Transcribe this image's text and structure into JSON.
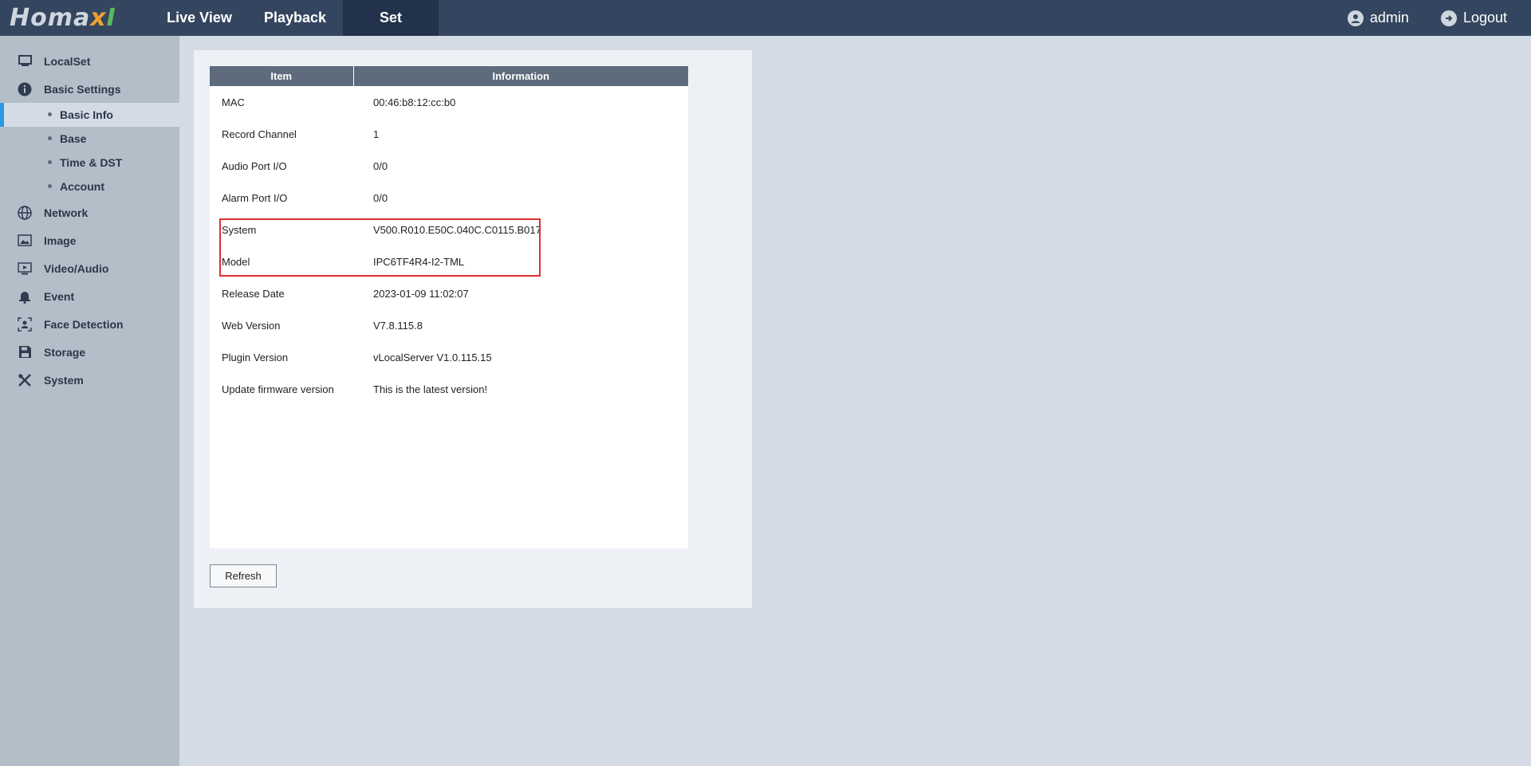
{
  "header": {
    "logo": {
      "part1": "Homa",
      "part2": "x",
      "part3": "I"
    },
    "tabs": [
      {
        "label": "Live View"
      },
      {
        "label": "Playback"
      },
      {
        "label": "Set",
        "active": true
      }
    ],
    "user": {
      "label": "admin",
      "icon": "user-icon"
    },
    "logout": {
      "label": "Logout",
      "icon": "logout-icon"
    },
    "bg_color": "#34465f",
    "active_tab_color": "#22324a"
  },
  "sidebar": {
    "items": [
      {
        "label": "LocalSet",
        "icon": "monitor-icon"
      },
      {
        "label": "Basic Settings",
        "icon": "info-icon"
      },
      {
        "label": "Network",
        "icon": "globe-icon"
      },
      {
        "label": "Image",
        "icon": "image-icon"
      },
      {
        "label": "Video/Audio",
        "icon": "video-icon"
      },
      {
        "label": "Event",
        "icon": "bell-icon"
      },
      {
        "label": "Face Detection",
        "icon": "face-scan-icon"
      },
      {
        "label": "Storage",
        "icon": "save-icon"
      },
      {
        "label": "System",
        "icon": "tools-icon"
      }
    ],
    "sub_items": [
      {
        "label": "Basic Info",
        "active": true
      },
      {
        "label": "Base"
      },
      {
        "label": "Time & DST"
      },
      {
        "label": "Account"
      }
    ],
    "accent_color": "#2a9ae0"
  },
  "table": {
    "headers": [
      "Item",
      "Information"
    ],
    "rows": [
      {
        "item": "MAC",
        "info": "00:46:b8:12:cc:b0"
      },
      {
        "item": "Record Channel",
        "info": "1"
      },
      {
        "item": "Audio Port I/O",
        "info": "0/0"
      },
      {
        "item": "Alarm Port I/O",
        "info": "0/0"
      },
      {
        "item": "System",
        "info": "V500.R010.E50C.040C.C0115.B017"
      },
      {
        "item": "Model",
        "info": "IPC6TF4R4-I2-TML"
      },
      {
        "item": "Release Date",
        "info": "2023-01-09 11:02:07"
      },
      {
        "item": "Web Version",
        "info": "V7.8.115.8"
      },
      {
        "item": "Plugin Version",
        "info": "vLocalServer V1.0.115.15"
      },
      {
        "item": "Update firmware version",
        "info": "This is the latest version!"
      }
    ],
    "highlight_color": "#e03030"
  },
  "actions": {
    "refresh_label": "Refresh"
  }
}
